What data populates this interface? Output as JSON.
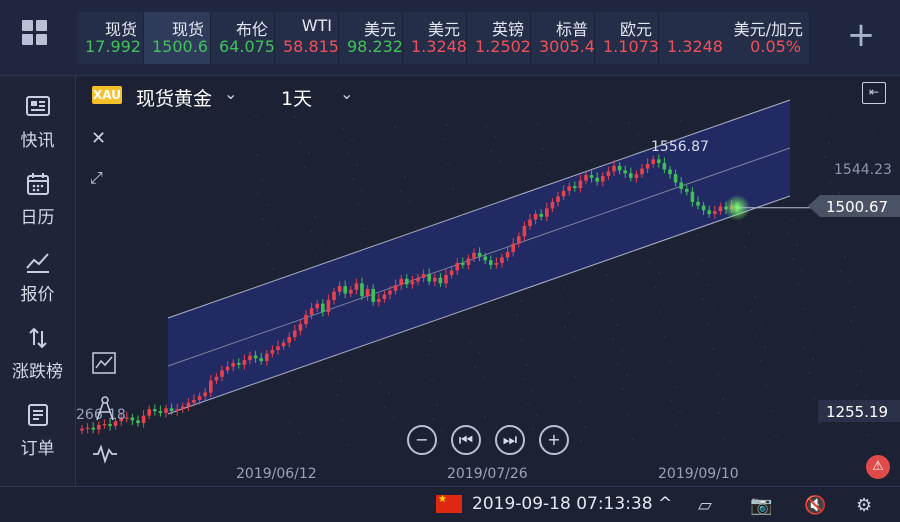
{
  "topbar": {
    "tickers": [
      {
        "name": "现货",
        "price": "17.992",
        "change": "",
        "trend": "down"
      },
      {
        "name": "现货",
        "price": "1500.6",
        "change": "",
        "trend": "down",
        "selected": true
      },
      {
        "name": "布伦",
        "price": "64.075",
        "change": "",
        "trend": "down"
      },
      {
        "name": "WTI",
        "price": "58.815",
        "change": "",
        "trend": "up"
      },
      {
        "name": "美元",
        "price": "98.232",
        "change": "",
        "trend": "down"
      },
      {
        "name": "美元",
        "price": "1.3248",
        "change": "",
        "trend": "up"
      },
      {
        "name": "英镑",
        "price": "1.2502",
        "change": "",
        "trend": "up"
      },
      {
        "name": "标普",
        "price": "3005.4",
        "change": "",
        "trend": "up"
      },
      {
        "name": "欧元",
        "price": "1.1073",
        "change": "",
        "trend": "up"
      },
      {
        "name": "美元/加元",
        "price": "1.3248",
        "change": "0.05%",
        "trend": "up"
      }
    ]
  },
  "sidebar": {
    "items": [
      {
        "label": "快讯",
        "icon": "news-icon"
      },
      {
        "label": "日历",
        "icon": "calendar-icon"
      },
      {
        "label": "报价",
        "icon": "quote-chart-icon"
      },
      {
        "label": "涨跌榜",
        "icon": "updown-icon"
      },
      {
        "label": "订单",
        "icon": "order-icon"
      }
    ]
  },
  "chart": {
    "symbol_badge": "XAU",
    "symbol": "现货黄金",
    "timeframe": "1天",
    "price_high_label": "1556.87",
    "price_axis_top": "1544.23",
    "price_current": "1500.67",
    "price_axis_low": "1255.19",
    "left_value": "266",
    "left_value_tail": "18",
    "dates": [
      "2019/06/12",
      "2019/07/26",
      "2019/09/10"
    ]
  },
  "chart_data": {
    "type": "candlestick",
    "title": "现货黄金",
    "timeframe": "1天",
    "x_labels": [
      "2019/06/12",
      "2019/07/26",
      "2019/09/10"
    ],
    "y_labels": [
      "1544.23",
      "1500.67",
      "1255.19"
    ],
    "annotations": [
      "1556.87"
    ],
    "current_price": 1500.67,
    "overlay": "parallel channel",
    "closes": [
      1262,
      1263,
      1261,
      1266,
      1267,
      1265,
      1270,
      1273,
      1274,
      1271,
      1268,
      1276,
      1283,
      1281,
      1279,
      1284,
      1281,
      1283,
      1286,
      1290,
      1293,
      1297,
      1301,
      1314,
      1318,
      1325,
      1329,
      1333,
      1331,
      1336,
      1341,
      1338,
      1335,
      1343,
      1347,
      1351,
      1355,
      1361,
      1368,
      1375,
      1385,
      1392,
      1397,
      1388,
      1401,
      1410,
      1416,
      1408,
      1412,
      1419,
      1405,
      1413,
      1399,
      1402,
      1407,
      1411,
      1417,
      1424,
      1418,
      1421,
      1425,
      1429,
      1421,
      1425,
      1419,
      1428,
      1433,
      1441,
      1439,
      1446,
      1452,
      1448,
      1444,
      1439,
      1441,
      1447,
      1453,
      1462,
      1470,
      1481,
      1488,
      1494,
      1491,
      1500,
      1507,
      1513,
      1519,
      1524,
      1522,
      1530,
      1536,
      1533,
      1529,
      1535,
      1540,
      1546,
      1541,
      1538,
      1533,
      1537,
      1543,
      1548,
      1553,
      1549,
      1542,
      1537,
      1528,
      1521,
      1518,
      1507,
      1503,
      1498,
      1494,
      1497,
      1502,
      1499,
      1503,
      1500.67
    ]
  }
}
